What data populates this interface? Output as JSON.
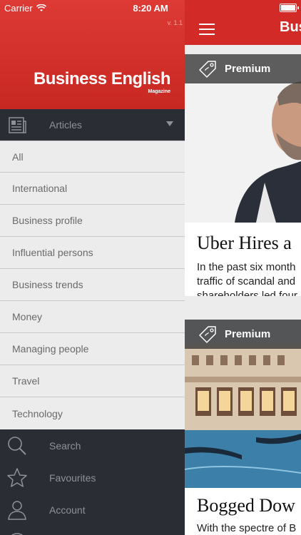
{
  "status_bar": {
    "carrier": "Carrier",
    "time": "8:20 AM"
  },
  "drawer": {
    "version": "v. 1.1",
    "logo_title": "Business English",
    "logo_subtitle": "Magazine",
    "articles_header": "Articles",
    "categories": [
      "All",
      "International",
      "Business profile",
      "Influential persons",
      "Business trends",
      "Money",
      "Managing people",
      "Travel",
      "Technology"
    ],
    "menu": [
      {
        "label": "Search",
        "icon": "search-icon"
      },
      {
        "label": "Favourites",
        "icon": "star-icon"
      },
      {
        "label": "Account",
        "icon": "user-icon"
      }
    ]
  },
  "content": {
    "header_title": "Bus",
    "cards": [
      {
        "badge": "Premium",
        "title": "Uber Hires a",
        "excerpt": [
          "In the past six month",
          "traffic of scandal and",
          "shareholders led four"
        ]
      },
      {
        "badge": "Premium",
        "title": "Bogged Dow",
        "excerpt": [
          "With the spectre of B"
        ]
      }
    ]
  },
  "colors": {
    "brand_red": "#d22b27",
    "drawer_dark": "#2a2d33",
    "list_bg": "#ececec"
  }
}
